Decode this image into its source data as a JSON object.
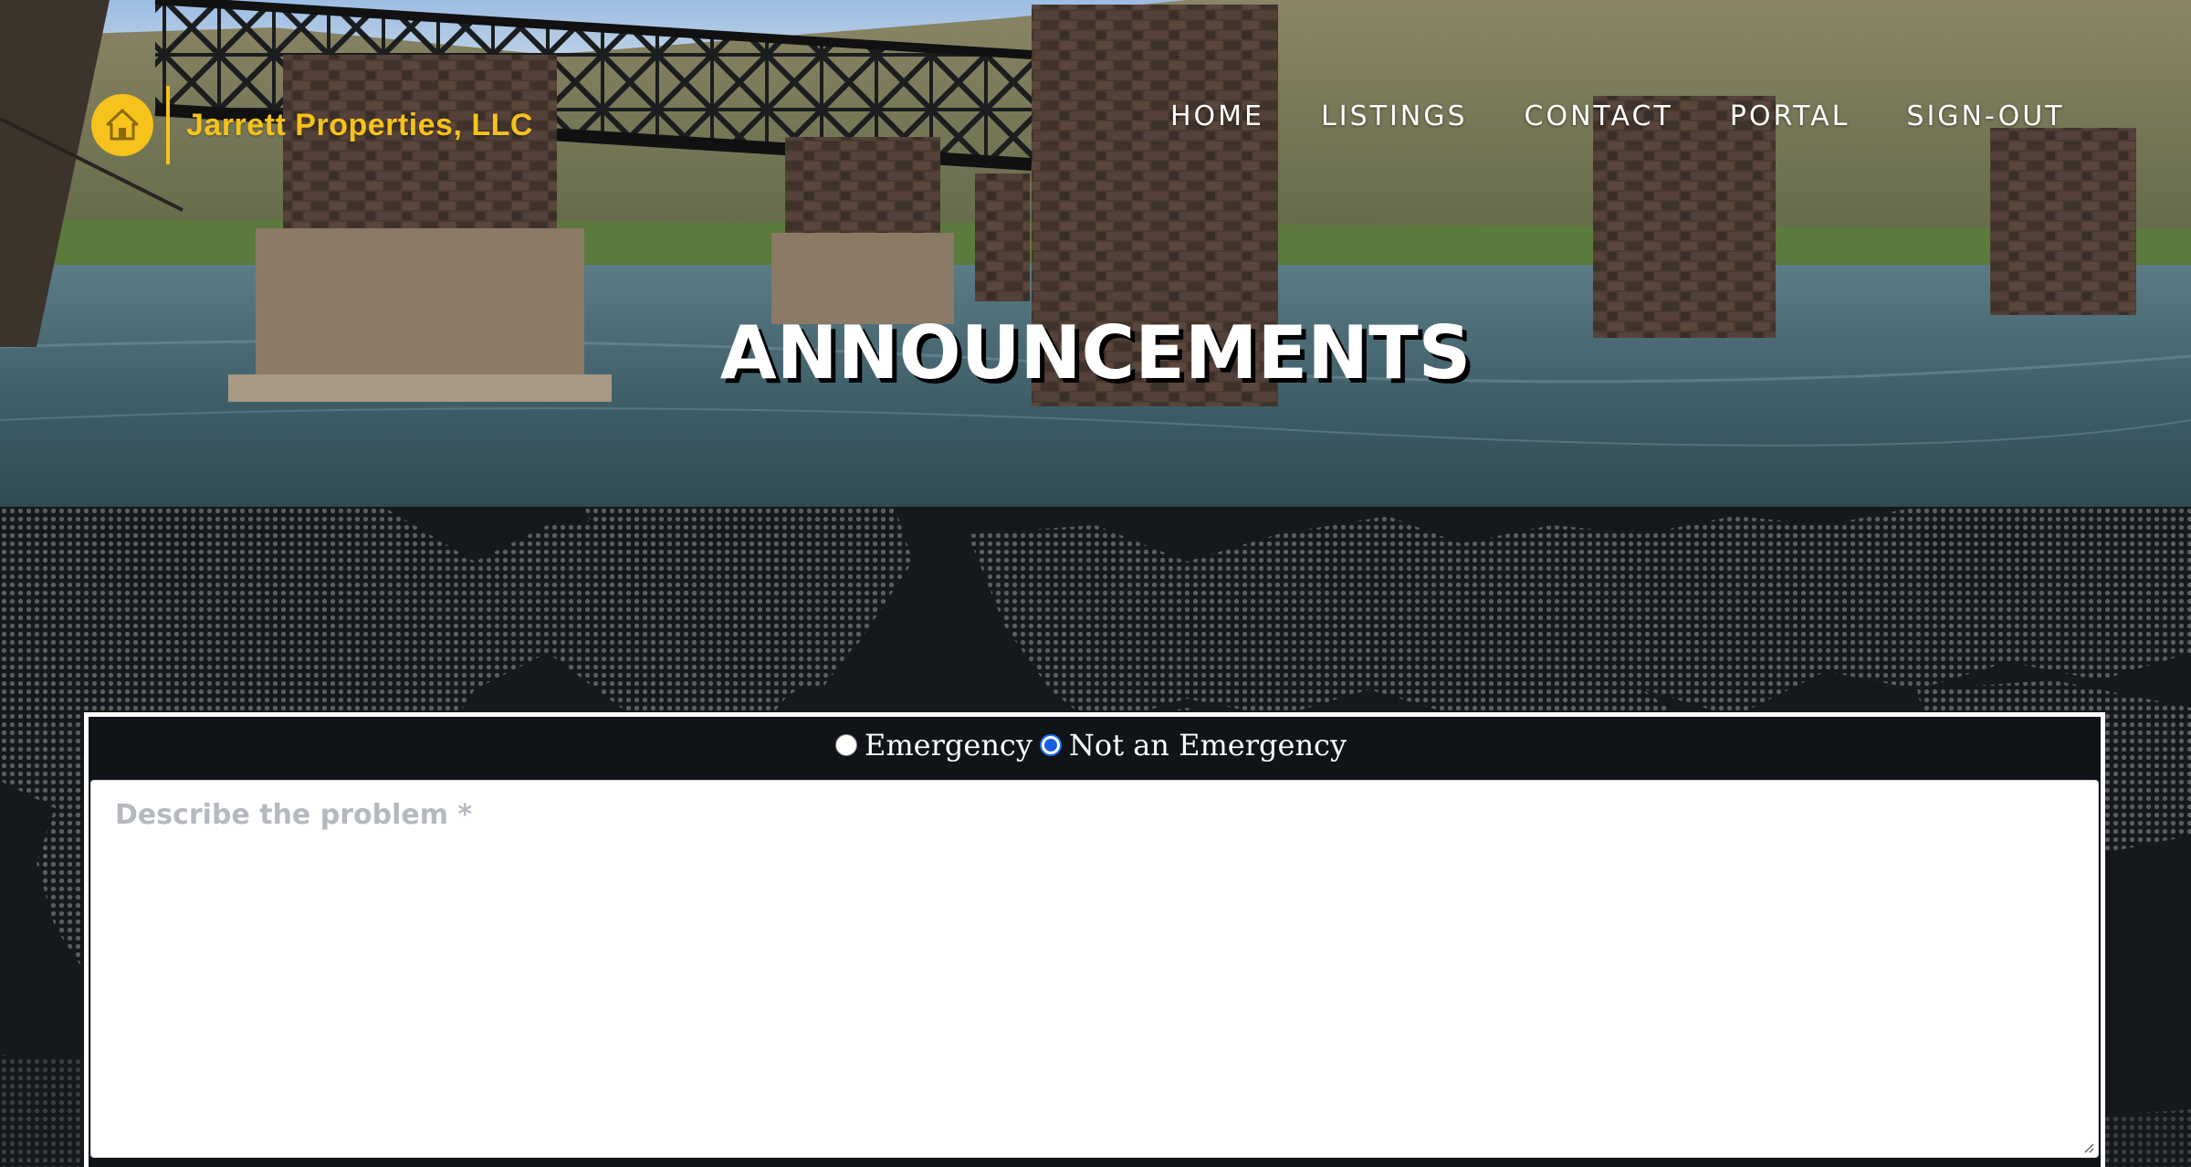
{
  "brand": {
    "name": "Jarrett Properties, LLC",
    "logo_icon": "house-icon",
    "accent_color": "#f6c21c"
  },
  "nav": {
    "items": [
      {
        "label": "HOME"
      },
      {
        "label": "LISTINGS"
      },
      {
        "label": "CONTACT"
      },
      {
        "label": "PORTAL"
      },
      {
        "label": "SIGN-OUT"
      }
    ]
  },
  "hero": {
    "title": "ANNOUNCEMENTS"
  },
  "form": {
    "radio_options": [
      {
        "label": "Emergency",
        "checked": false
      },
      {
        "label": "Not an Emergency",
        "checked": true
      }
    ],
    "problem_placeholder": "Describe the problem *",
    "problem_value": ""
  }
}
